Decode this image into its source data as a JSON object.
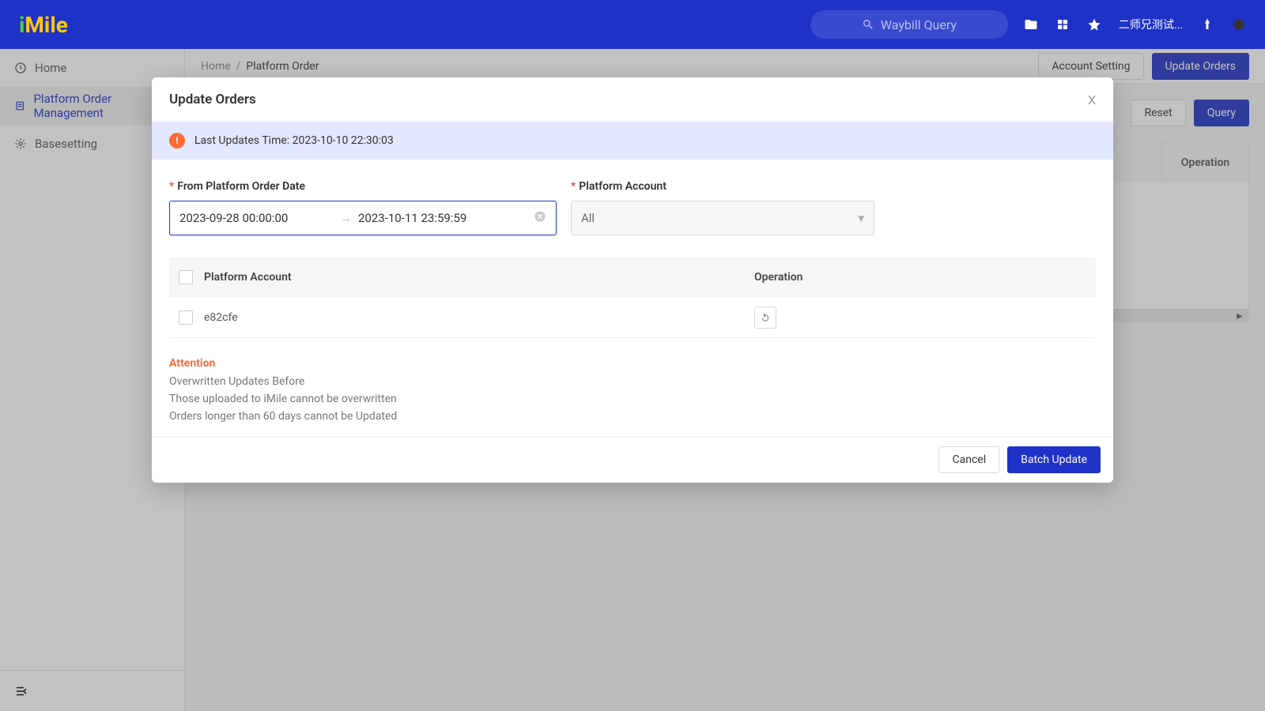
{
  "logo": {
    "part1": "i",
    "part2": "Mile"
  },
  "header": {
    "search_placeholder": "Waybill Query",
    "user_name": "二师兄测试..."
  },
  "sidebar": {
    "items": [
      {
        "label": "Home"
      },
      {
        "label": "Platform Order Management"
      },
      {
        "label": "Basesetting"
      }
    ]
  },
  "breadcrumb": {
    "root": "Home",
    "current": "Platform Order"
  },
  "subheader": {
    "account_setting": "Account Setting",
    "update_orders": "Update Orders"
  },
  "filter": {
    "reset": "Reset",
    "query": "Query"
  },
  "table": {
    "operation": "Operation"
  },
  "modal": {
    "title": "Update Orders",
    "banner_prefix": "Last Updates Time: ",
    "banner_time": "2023-10-10 22:30:03",
    "field1_label": "From Platform Order Date",
    "date_start": "2023-09-28 00:00:00",
    "date_end": "2023-10-11 23:59:59",
    "field2_label": "Platform Account",
    "field2_value": "All",
    "tbl_col1": "Platform Account",
    "tbl_col2": "Operation",
    "rows": [
      {
        "name": "e82cfe"
      }
    ],
    "attention_title": "Attention",
    "attention_lines": [
      "Overwritten Updates Before",
      "Those uploaded to iMile cannot be overwritten",
      "Orders longer than 60 days cannot be Updated"
    ],
    "cancel": "Cancel",
    "batch_update": "Batch Update"
  }
}
